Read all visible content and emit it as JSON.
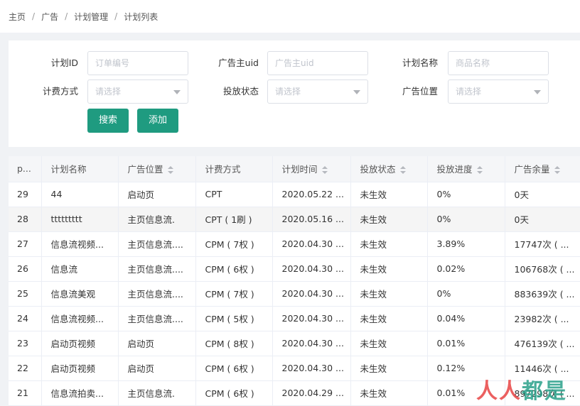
{
  "breadcrumb": [
    "主页",
    "广告",
    "计划管理",
    "计划列表"
  ],
  "filters": {
    "plan_id_label": "计划ID",
    "plan_id_placeholder": "订单编号",
    "advertiser_uid_label": "广告主uid",
    "advertiser_uid_placeholder": "广告主uid",
    "plan_name_label": "计划名称",
    "plan_name_placeholder": "商品名称",
    "billing_label": "计费方式",
    "billing_value": "请选择",
    "status_label": "投放状态",
    "status_value": "请选择",
    "position_label": "广告位置",
    "position_value": "请选择"
  },
  "buttons": {
    "search": "搜索",
    "add": "添加"
  },
  "table": {
    "headers": [
      "p...",
      "计划名称",
      "广告位置",
      "计费方式",
      "计划时间",
      "投放状态",
      "投放进度",
      "广告余量"
    ],
    "rows": [
      [
        "29",
        "44",
        "启动页",
        "CPT",
        "2020.05.22 ...",
        "未生效",
        "0%",
        "0天"
      ],
      [
        "28",
        "ttttttttt",
        "主页信息流.",
        "CPT ( 1刷 )",
        "2020.05.16 ...",
        "未生效",
        "0%",
        "0天"
      ],
      [
        "27",
        "信息流视频...",
        "主页信息流....",
        "CPM ( 7权 )",
        "2020.04.30 ...",
        "未生效",
        "3.89%",
        "17747次 ( ..."
      ],
      [
        "26",
        "信息流",
        "主页信息流....",
        "CPM ( 6权 )",
        "2020.04.30 ...",
        "未生效",
        "0.02%",
        "106768次 ( ..."
      ],
      [
        "25",
        "信息流美观",
        "主页信息流....",
        "CPM ( 7权 )",
        "2020.04.30 ...",
        "未生效",
        "0%",
        "883639次 ( ..."
      ],
      [
        "24",
        "信息流视频...",
        "主页信息流....",
        "CPM ( 5权 )",
        "2020.04.30 ...",
        "未生效",
        "0.04%",
        "23982次 ( ..."
      ],
      [
        "23",
        "启动页视频",
        "启动页",
        "CPM ( 8权 )",
        "2020.04.30 ...",
        "未生效",
        "0.01%",
        "476139次 ( ..."
      ],
      [
        "22",
        "启动页视频",
        "启动页",
        "CPM ( 6权 )",
        "2020.04.30 ...",
        "未生效",
        "0.12%",
        "11446次 ( ..."
      ],
      [
        "21",
        "信息流拍卖...",
        "主页信息流.",
        "CPM ( 6权 )",
        "2020.04.29 ...",
        "未生效",
        "0.01%",
        "897298次 ( ..."
      ]
    ]
  },
  "watermark": {
    "part1": "人人",
    "part2": "都是"
  },
  "colors": {
    "primary": "#1f9b80"
  }
}
